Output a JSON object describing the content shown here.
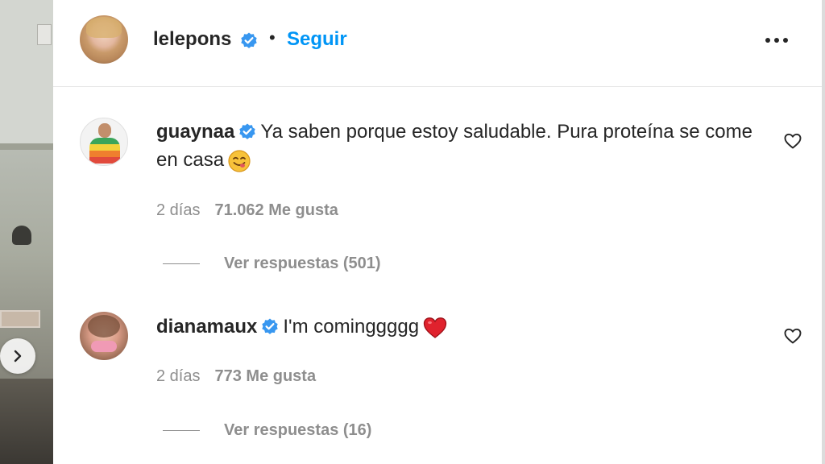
{
  "post": {
    "owner_username": "lelepons",
    "follow_label": "Seguir",
    "separator": "•"
  },
  "comments": [
    {
      "username": "guaynaa",
      "text": "Ya saben porque estoy saludable. Pura proteína se come en casa",
      "emoji": "savoring-face-emoji",
      "time": "2 días",
      "likes": "71.062 Me gusta",
      "replies": "Ver respuestas (501)"
    },
    {
      "username": "dianamaux",
      "text": "I'm cominggggg",
      "emoji": "red-heart-emoji",
      "time": "2 días",
      "likes": "773 Me gusta",
      "replies": "Ver respuestas (16)"
    }
  ],
  "colors": {
    "accent": "#0095f6",
    "verified": "#3897f0",
    "secondary_text": "#8e8e8e",
    "primary_text": "#262626"
  },
  "icons": [
    "verified-badge-icon",
    "more-options-icon",
    "heart-outline-icon",
    "chevron-right-icon"
  ]
}
